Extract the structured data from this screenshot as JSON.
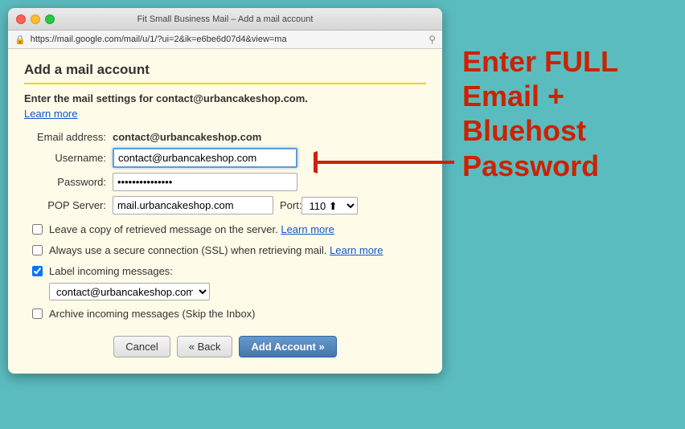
{
  "window": {
    "title": "Fit Small Business Mail – Add a mail account",
    "url": "https://mail.google.com/mail/u/1/?ui=2&ik=e6be6d07d4&view=ma"
  },
  "dialog": {
    "title": "Add a mail account",
    "instruction_bold": "Enter the mail settings for contact@urbancakeshop.com.",
    "learn_more_label": "Learn more"
  },
  "form": {
    "email_label": "Email address:",
    "email_value": "contact@urbancakeshop.com",
    "username_label": "Username:",
    "username_value": "contact@urbancakeshop.com",
    "password_label": "Password:",
    "password_value": "•••••••••••••",
    "popserver_label": "POP Server:",
    "popserver_value": "mail.urbancakeshop.com",
    "port_label": "Port:",
    "port_value": "110"
  },
  "checkboxes": {
    "copy_label": "Leave a copy of retrieved message on the server.",
    "copy_learn_more": "Learn more",
    "ssl_label": "Always use a secure connection (SSL) when retrieving mail.",
    "ssl_learn_more": "Learn more",
    "label_incoming_label": "Label incoming messages:",
    "label_value": "contact@urbancakeshop.com",
    "archive_label": "Archive incoming messages (Skip the Inbox)"
  },
  "buttons": {
    "cancel": "Cancel",
    "back": "« Back",
    "add_account": "Add Account »"
  },
  "annotation": {
    "line1": "Enter FULL",
    "line2": "Email +",
    "line3": "Bluehost",
    "line4": "Password"
  }
}
